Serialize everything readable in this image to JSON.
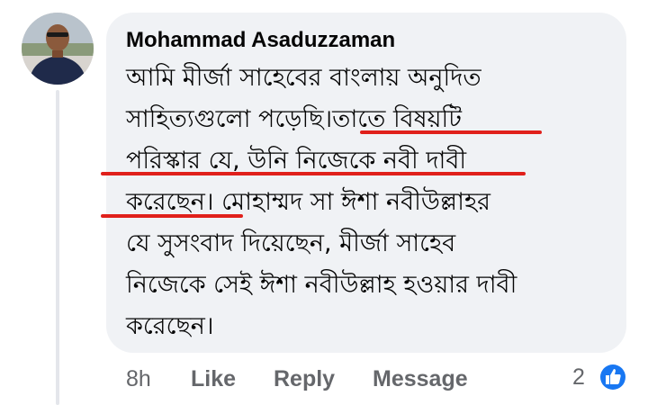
{
  "comment": {
    "author": "Mohammad Asaduzzaman",
    "text_lines": [
      "আমি মীর্জা সাহেবের বাংলায় অনুদিত",
      "সাহিত্যগুলো পড়েছি।তাতে বিষয়টি",
      "পরিস্কার যে, উনি নিজেকে নবী দাবী",
      "করেছেন। মোহাম্মদ সা  ঈশা নবীউল্লাহর",
      "যে সুসংবাদ দিয়েছেন, মীর্জা সাহেব",
      "নিজেকে সেই ঈশা নবীউল্লাহ হওয়ার দাবী",
      "করেছেন।"
    ],
    "underline_color": "#e0201b"
  },
  "actions": {
    "time": "8h",
    "like": "Like",
    "reply": "Reply",
    "message": "Message"
  },
  "reactions": {
    "count": "2",
    "icon": "like-reaction-icon",
    "color": "#1877f2"
  }
}
